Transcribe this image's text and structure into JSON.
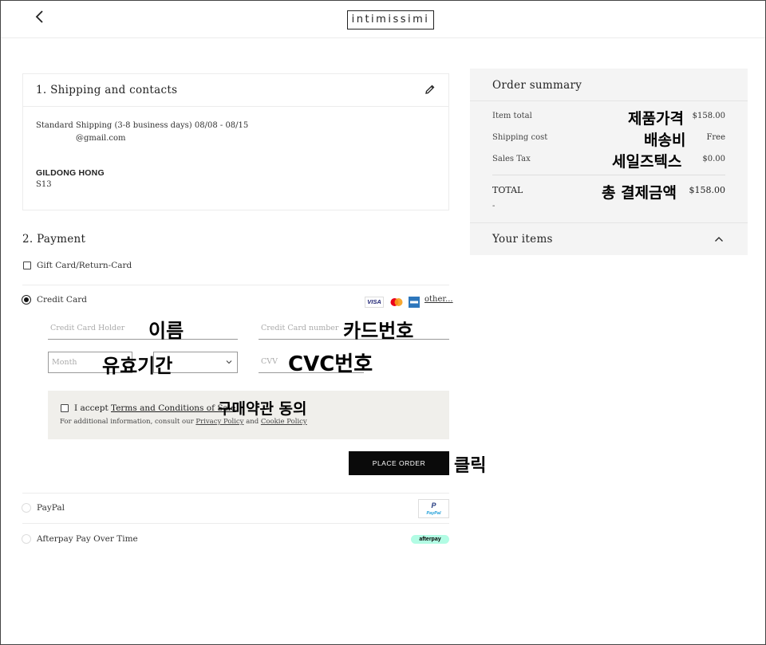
{
  "header": {
    "logo": "intimissimi"
  },
  "shipping": {
    "title": "1. Shipping and contacts",
    "method": "Standard Shipping (3-8 business days) 08/08 - 08/15",
    "email": "@gmail.com",
    "name": "GILDONG HONG",
    "code": "S13"
  },
  "payment": {
    "title": "2. Payment",
    "gift_card_label": "Gift Card/Return-Card",
    "credit_card_label": "Credit Card",
    "card_logos": [
      "VISA",
      "mastercard",
      "amex"
    ],
    "other_link": "other...",
    "holder_placeholder": "Credit Card Holder",
    "number_placeholder": "Credit Card number",
    "month_placeholder": "Month",
    "cvv_placeholder": "CVV",
    "terms_prefix": "I accept",
    "terms_link": "Terms and Conditions of Sale",
    "info_prefix": "For additional information, consult our",
    "privacy_link": "Privacy Policy",
    "and_text": "and",
    "cookie_link": "Cookie Policy",
    "place_order": "PLACE ORDER",
    "paypal_label": "PayPal",
    "paypal_logo": "PayPal",
    "afterpay_label": "Afterpay Pay Over Time",
    "afterpay_logo": "afterpay"
  },
  "summary": {
    "title": "Order summary",
    "rows": [
      {
        "label": "Item total",
        "value": "$158.00"
      },
      {
        "label": "Shipping cost",
        "value": "Free"
      },
      {
        "label": "Sales Tax",
        "value": "$0.00"
      }
    ],
    "total_label": "TOTAL",
    "total_value": "$158.00",
    "total_sub": "-",
    "your_items": "Your items"
  },
  "annotations": {
    "item_price": "제품가격",
    "shipping_fee": "배송비",
    "sales_tax": "세일즈텍스",
    "total_payment": "총 결제금액",
    "name": "이름",
    "card_number": "카드번호",
    "expiry": "유효기간",
    "cvc": "CVC번호",
    "terms_agree": "구매약관 동의",
    "click": "클릭"
  },
  "colors": {
    "button": "#0a0a0a",
    "summary_bg": "#f4f4f4",
    "terms_bg": "#f0efeb",
    "afterpay": "#b2fce4",
    "amex": "#2e77bc"
  }
}
